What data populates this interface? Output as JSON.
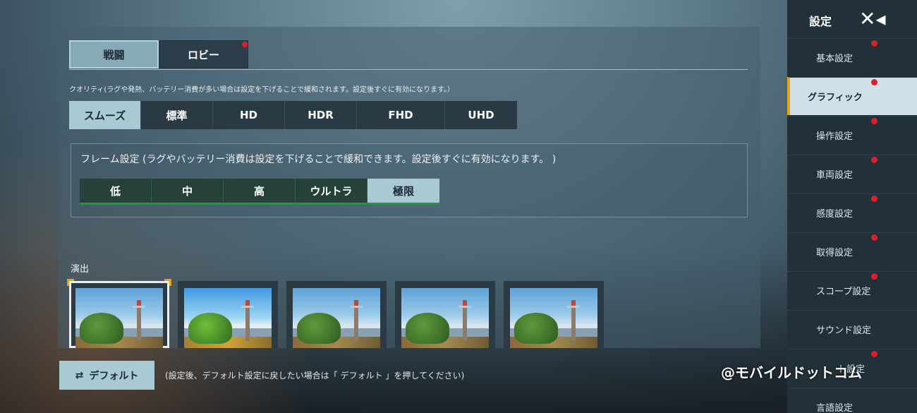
{
  "top_tabs": [
    {
      "label": "戦闘",
      "active": true,
      "badge": false
    },
    {
      "label": "ロビー",
      "active": false,
      "badge": true
    }
  ],
  "quality": {
    "label": "クオリティ(ラグや発熱、バッテリー消費が多い場合は設定を下げることで緩和されます。設定後すぐに有効になります。）",
    "options": [
      "スムーズ",
      "標準",
      "HD",
      "HDR",
      "FHD",
      "UHD"
    ],
    "selected": "スムーズ"
  },
  "frame": {
    "label": "フレーム設定 (ラグやバッテリー消費は設定を下げることで緩和できます。設定後すぐに有効になります。 )",
    "options": [
      "低",
      "中",
      "高",
      "ウルトラ",
      "極限"
    ],
    "selected": "極限"
  },
  "effects": {
    "label": "演出",
    "thumbnails": 5,
    "selected_index": 0
  },
  "footer": {
    "default_button": "デフォルト",
    "note": "(設定後、デフォルト設定に戻したい場合は「 デフォルト 」を押してください)"
  },
  "watermark": "@モバイルドットコム",
  "sidebar": {
    "title": "設定",
    "items": [
      {
        "label": "基本設定",
        "badge": true,
        "active": false
      },
      {
        "label": "グラフィック",
        "badge": true,
        "active": true
      },
      {
        "label": "操作設定",
        "badge": true,
        "active": false
      },
      {
        "label": "車両設定",
        "badge": true,
        "active": false
      },
      {
        "label": "感度設定",
        "badge": true,
        "active": false
      },
      {
        "label": "取得設定",
        "badge": true,
        "active": false
      },
      {
        "label": "スコープ設定",
        "badge": true,
        "active": false
      },
      {
        "label": "サウンド設定",
        "badge": false,
        "active": false
      },
      {
        "label": "ト設定",
        "badge": true,
        "active": false
      },
      {
        "label": "言語設定",
        "badge": false,
        "active": false
      }
    ]
  },
  "colors": {
    "accent": "#a9c9d3",
    "badge": "#e01e2a",
    "frame_underline": "#1f9a3c",
    "selection_corner": "#e3a51a"
  }
}
